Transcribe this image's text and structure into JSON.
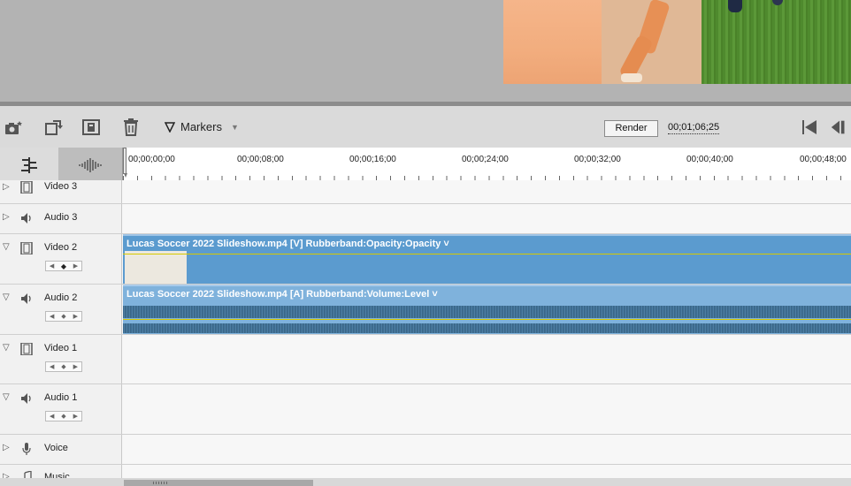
{
  "toolbar": {
    "markers_label": "Markers",
    "render_label": "Render",
    "timecode": "00;01;06;25"
  },
  "ruler": {
    "labels": [
      "00;00;00;00",
      "00;00;08;00",
      "00;00;16;00",
      "00;00;24;00",
      "00;00;32;00",
      "00;00;40;00",
      "00;00;48;00"
    ]
  },
  "tracks": {
    "video3": "Video 3",
    "audio3": "Audio 3",
    "video2": "Video 2",
    "audio2": "Audio 2",
    "video1": "Video 1",
    "audio1": "Audio 1",
    "voice": "Voice",
    "music": "Music"
  },
  "clips": {
    "video_clip_title": "Lucas Soccer 2022 Slideshow.mp4 [V]  Rubberband:Opacity:Opacity ˅",
    "audio_clip_title": "Lucas Soccer 2022 Slideshow.mp4 [A]  Rubberband:Volume:Level ˅"
  },
  "colors": {
    "clip_video": "#5b9bcf",
    "clip_audio": "#7fb2dc",
    "rubberband": "#e5d900"
  }
}
